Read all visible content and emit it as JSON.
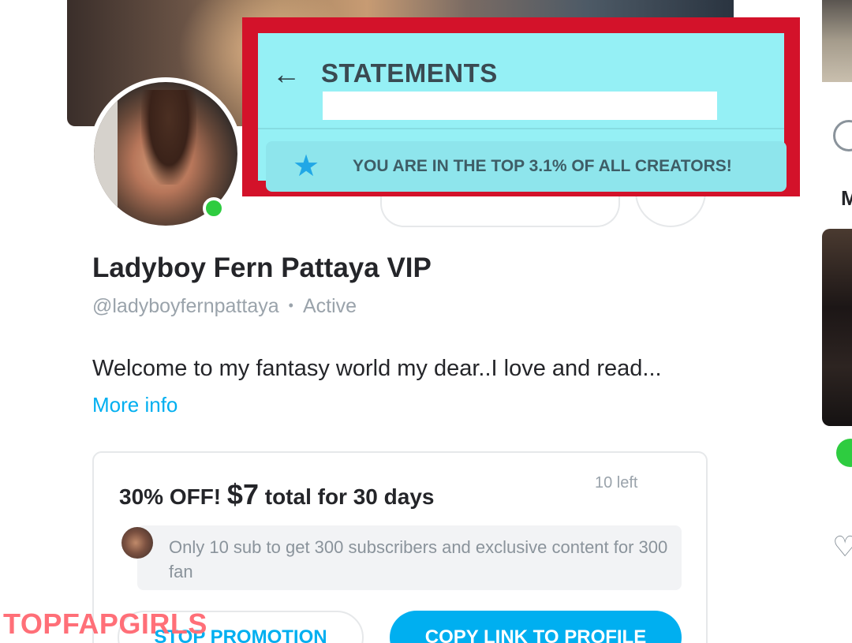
{
  "statements_overlay": {
    "title": "STATEMENTS",
    "back_icon": "arrow-left-icon",
    "top_banner_icon": "star-icon",
    "top_banner_text": "YOU ARE IN THE TOP 3.1% OF ALL CREATORS!",
    "highlight_color": "#d3122a",
    "overlay_bg": "#95f0f5"
  },
  "profile": {
    "name": "Ladyboy Fern Pattaya VIP",
    "handle": "@ladyboyfernpattaya",
    "separator": "•",
    "status": "Active",
    "bio": "Welcome to my fantasy world my dear..I love and read...",
    "more_info": "More info",
    "online_color": "#2ecc40"
  },
  "promotion": {
    "title_prefix": "30% OFF!",
    "price": "$7",
    "title_suffix": "total for 30 days",
    "remaining": "10 left",
    "message": "Only 10 sub to get 300 subscribers and exclusive content for 300 fan",
    "stop_button": "STOP PROMOTION",
    "copy_button": "COPY LINK TO PROFILE",
    "accent_color": "#00aff0"
  },
  "sidebar": {
    "partial_letter": "M"
  },
  "watermark": {
    "text": "TOPFAPGIRLS"
  }
}
